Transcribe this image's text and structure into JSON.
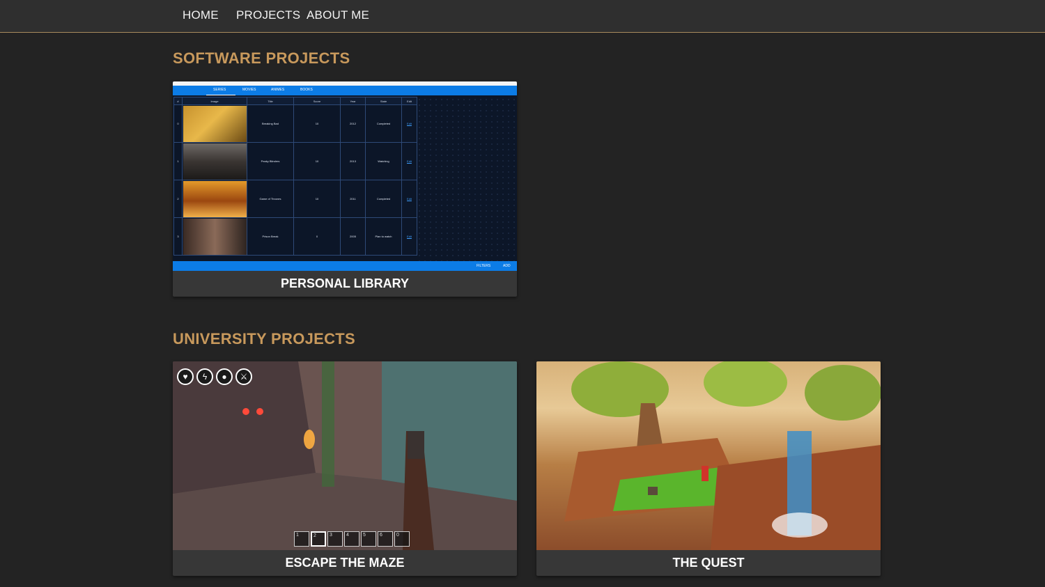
{
  "nav": {
    "items": [
      "HOME",
      "PROJECTS",
      "ABOUT ME"
    ]
  },
  "sections": {
    "software": {
      "title": "SOFTWARE PROJECTS"
    },
    "university": {
      "title": "UNIVERSITY PROJECTS"
    }
  },
  "cards": {
    "personal_library": {
      "label": "PERSONAL LIBRARY",
      "screenshot": {
        "tabs": [
          "SERIES",
          "MOVIES",
          "ANIMES",
          "BOOKS"
        ],
        "columns": [
          "#",
          "Image",
          "Title",
          "Score",
          "Year",
          "State",
          "Edit"
        ],
        "rows": [
          {
            "index": "0",
            "title": "Breaking Bad",
            "score": "10",
            "year": "2012",
            "state": "Completed",
            "edit": "Edit"
          },
          {
            "index": "1",
            "title": "Peaky Blinders",
            "score": "10",
            "year": "2013",
            "state": "Watching",
            "edit": "Edit"
          },
          {
            "index": "2",
            "title": "Game of Thrones",
            "score": "10",
            "year": "2011",
            "state": "Completed",
            "edit": "Edit"
          },
          {
            "index": "3",
            "title": "Prison Break",
            "score": "0",
            "year": "2005",
            "state": "Plan to watch",
            "edit": "Edit"
          }
        ],
        "bottom_actions": [
          "FILTERS",
          "ADD"
        ]
      }
    },
    "escape_the_maze": {
      "label": "ESCAPE THE MAZE",
      "hud_icons": [
        "heart-icon",
        "lightning-icon",
        "drop-icon",
        "sword-icon"
      ],
      "hotbar": [
        "1",
        "2",
        "3",
        "4",
        "5",
        "6",
        "0"
      ]
    },
    "the_quest": {
      "label": "THE QUEST"
    }
  },
  "colors": {
    "background": "#232323",
    "nav_background": "#2f2f2f",
    "accent": "#c8995c",
    "card_background": "#373737",
    "library_blue": "#0c7ce6"
  }
}
